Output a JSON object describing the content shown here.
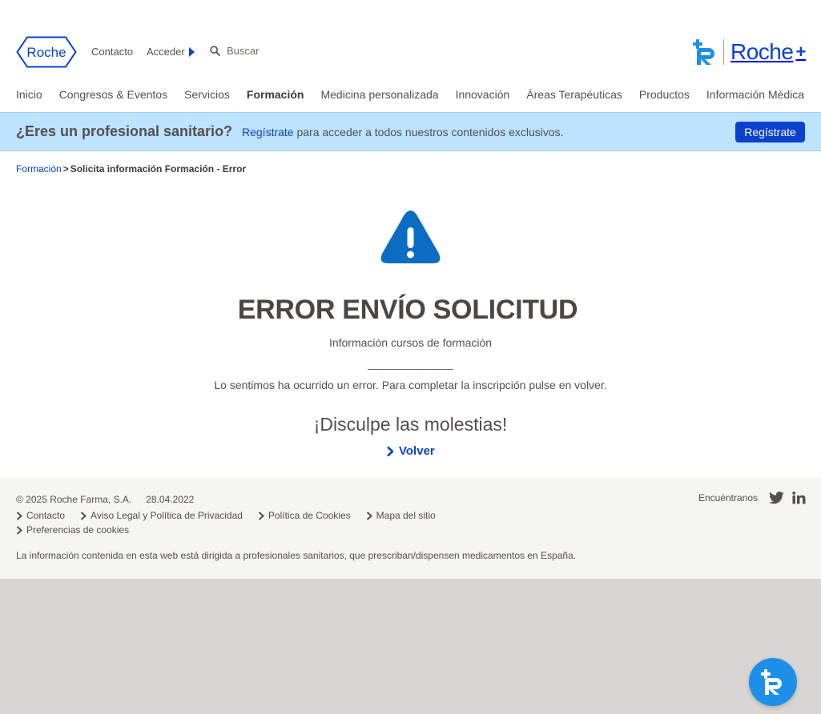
{
  "colors": {
    "brand_blue": "#0b41cd",
    "banner_bg": "#bde3ff",
    "footer_bg": "#f5f5f2",
    "alert_blue": "#0a6dc3",
    "fab_blue": "#1e8fe8"
  },
  "header": {
    "logo_text": "Roche",
    "contacto": "Contacto",
    "acceder": "Acceder",
    "search_placeholder": "Buscar",
    "roche_plus": {
      "word": "Roche",
      "suffix": "+"
    }
  },
  "nav": {
    "items": [
      {
        "label": "Inicio"
      },
      {
        "label": "Congresos & Eventos"
      },
      {
        "label": "Servicios"
      },
      {
        "label": "Formación",
        "active": true
      },
      {
        "label": "Medicina personalizada"
      },
      {
        "label": "Innovación"
      },
      {
        "label": "Áreas Terapéuticas"
      },
      {
        "label": "Productos"
      },
      {
        "label": "Información Médica"
      }
    ]
  },
  "banner": {
    "title": "¿Eres un profesional sanitario?",
    "link": "Regístrate",
    "text": " para acceder a todos nuestros contenidos exclusivos.",
    "button": "Regístrate"
  },
  "breadcrumb": {
    "parent": "Formación",
    "separator": ">",
    "current": "Solicita información Formación - Error"
  },
  "main": {
    "icon": "warning-triangle-icon",
    "title": "ERROR ENVÍO SOLICITUD",
    "subtitle": "Información cursos de formación",
    "dashes": "_____________",
    "message": "Lo sentimos ha ocurrido un error. Para completar la inscripción pulse en volver.",
    "apology": "¡Disculpe las molestias!",
    "back_link": "Volver"
  },
  "footer": {
    "copyright": "© 2025 Roche Farma, S.A.",
    "date": "28.04.2022",
    "links": [
      {
        "label": "Contacto"
      },
      {
        "label": "Aviso Legal y Política de Privacidad"
      },
      {
        "label": "Política de Cookies"
      },
      {
        "label": "Mapa del sitio"
      },
      {
        "label": "Preferencias de cookies"
      }
    ],
    "disclaimer": "La información contenida en esta web está dirigida a profesionales sanitarios, que prescriban/dispensen medicamentos en España.",
    "social_label": "Encuéntranos",
    "social": [
      "twitter-icon",
      "linkedin-icon"
    ]
  },
  "fab": {
    "icon": "roche-plus-icon"
  }
}
